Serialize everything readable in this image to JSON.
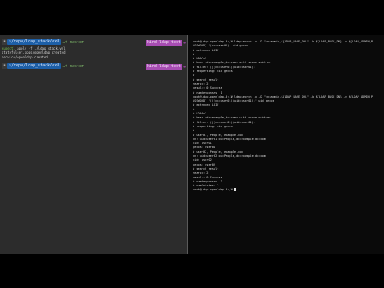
{
  "left_pane": {
    "prompt1": {
      "os_glyph": "☀",
      "dir": "~/repo/ldap_stack/ex8",
      "git_branch": "master",
      "context": "kind-ldap-test"
    },
    "command": {
      "program": "kubectl",
      "args": "apply -f ./ldap_stack.yml"
    },
    "output": [
      "statefulset.apps/openldap created",
      "service/openldap created"
    ],
    "prompt2": {
      "os_glyph": "☀",
      "dir": "~/repo/ldap_stack/ex8",
      "git_branch": "master",
      "context": "kind-ldap-test"
    }
  },
  "right_pane": {
    "lines": [
      "root@ldap-openldap-0:/# ldapsearch -x -D \"cn=admin,${LDAP_BASE_DN}\" -b ${LDAP_BASE_DN} -w ${LDAP_ADMIN_P",
      "ASSWORD} '(cn=user01)' uid gecos",
      "# extended LDIF",
      "#",
      "# LDAPv3",
      "# base <dc=example,dc=com> with scope subtree",
      "# filter: (|(cn=user01)(uid=user01))",
      "# requesting: uid gecos",
      "#",
      "",
      "# search result",
      "search: 2",
      "result: 0 Success",
      "",
      "# numResponses: 1",
      "root@ldap-openldap-0:/# ldapsearch -x -D \"cn=admin,${LDAP_BASE_DN}\" -b ${LDAP_BASE_DN} -w ${LDAP_ADMIN_P",
      "ASSWORD} '(|(cn=user01)(uid=user01))' uid gecos",
      "# extended LDIF",
      "#",
      "# LDAPv3",
      "# base <dc=example,dc=com> with scope subtree",
      "# filter: (|(cn=user01)(uid=user01))",
      "# requesting: uid gecos",
      "#",
      "",
      "# user01, People, example.com",
      "dn: uid=user01,ou=People,dc=example,dc=com",
      "uid: user01",
      "gecos: user01",
      "",
      "# user02, People, example.com",
      "dn: uid=user02,ou=People,dc=example,dc=com",
      "uid: user02",
      "gecos: user02",
      "",
      "# search result",
      "search: 2",
      "result: 0 Success",
      "",
      "# numResponses: 3",
      "# numEntries: 2",
      "root@ldap-openldap-0:/# "
    ]
  },
  "colors": {
    "left_bg": "#2c2c2c",
    "right_bg": "#0a0a0a",
    "dir_segment": "#1d5fa7",
    "context_segment": "#a84db3",
    "command_green": "#78c24f"
  }
}
